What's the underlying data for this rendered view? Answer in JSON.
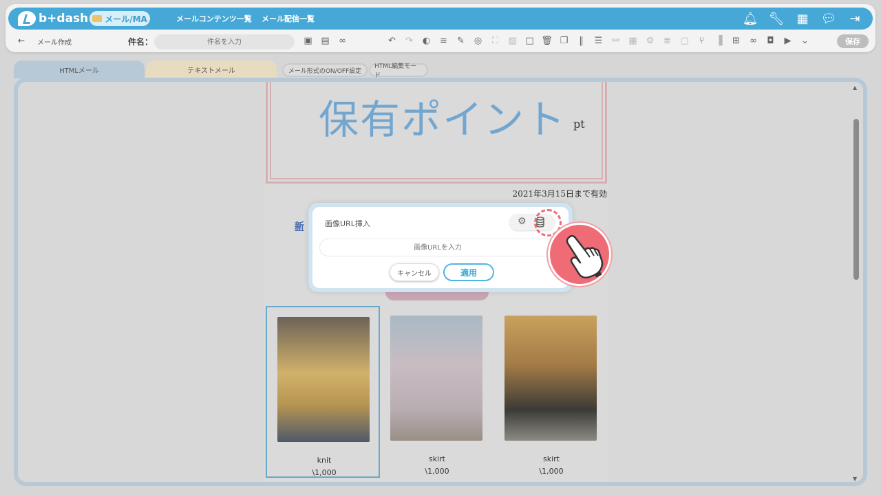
{
  "app": {
    "logo_text": "b+dash"
  },
  "nav": {
    "active": "メール/MA",
    "links": [
      "メールコンテンツ一覧",
      "メール配信一覧"
    ]
  },
  "toolbar": {
    "back_label": "←",
    "page_name": "メール作成",
    "subject_label": "件名：",
    "subject_placeholder": "件名を入力",
    "save_label": "保存"
  },
  "tabs": {
    "html": "HTMLメール",
    "text": "テキストメール",
    "toggle": "メール形式のON/OFF設定",
    "html_edit": "HTML編集モード"
  },
  "content": {
    "points_title": "保有ポイント",
    "points_unit": "pt",
    "validity": "2021年3月15日まで有効",
    "new_text": "新",
    "products": [
      {
        "name": "knit",
        "price": "\\1,000"
      },
      {
        "name": "skirt",
        "price": "\\1,000"
      },
      {
        "name": "skirt",
        "price": "\\1,000"
      }
    ]
  },
  "modal": {
    "title": "画像URL挿入",
    "url_placeholder": "画像URLを入力",
    "cancel_label": "キャンセル",
    "apply_label": "適用"
  },
  "colors": {
    "brand": "#46a8d6",
    "accent_pink": "#ef6b75",
    "tab_html": "#b7c8d6",
    "tab_text": "#e7dcc0"
  }
}
